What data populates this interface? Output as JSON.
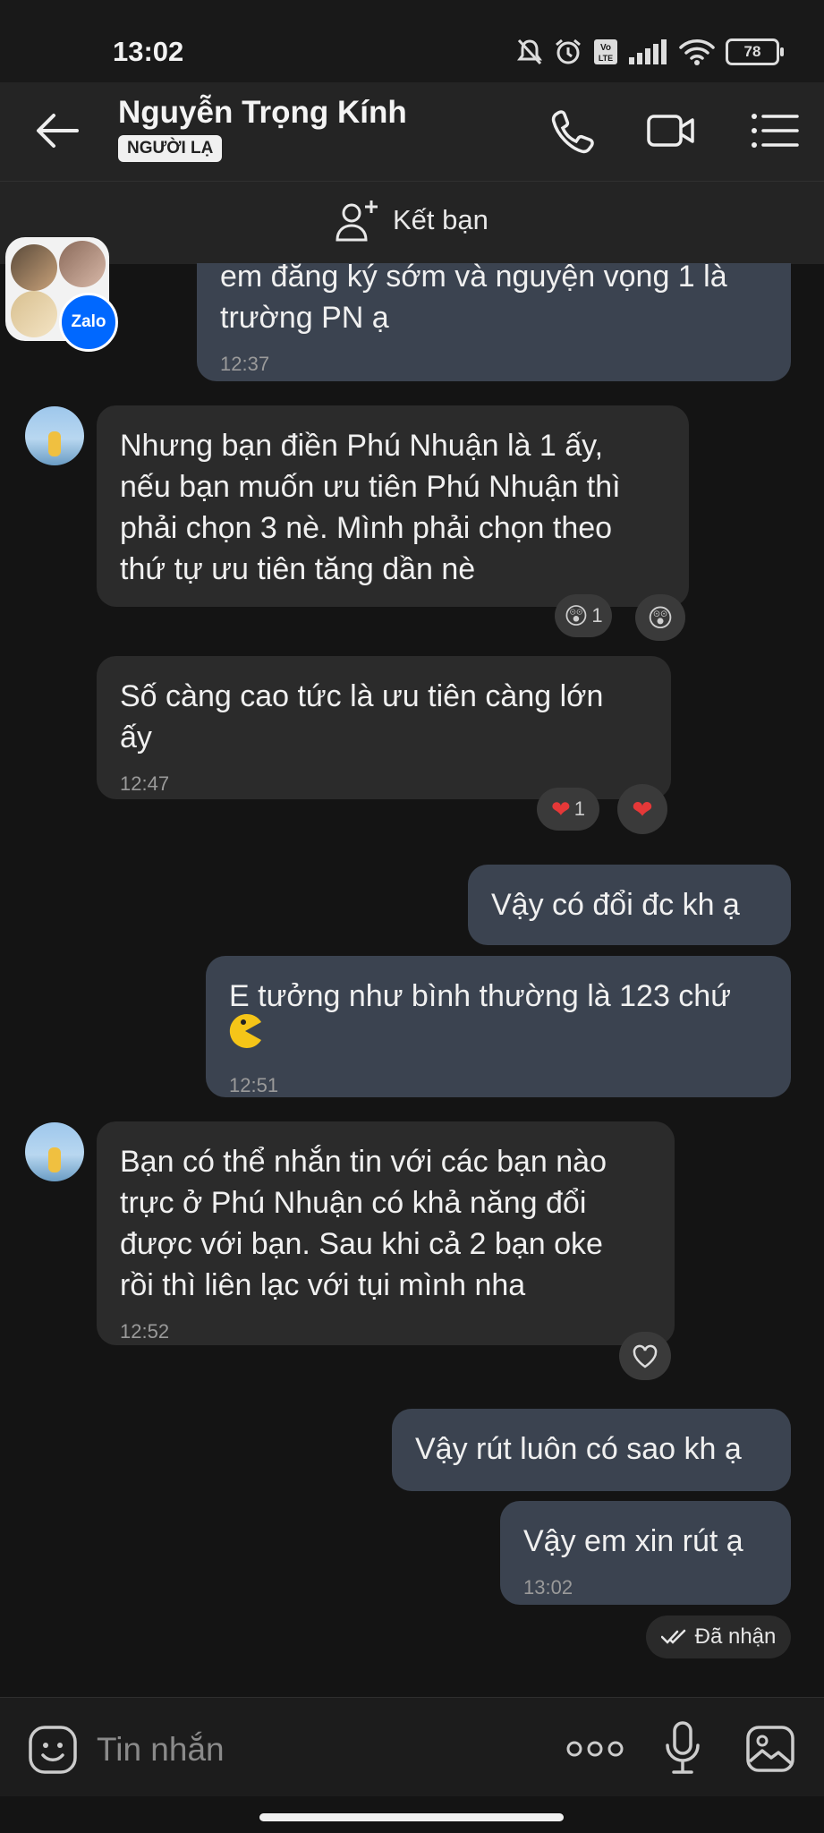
{
  "status_bar": {
    "time": "13:02",
    "network": "Vo LTE",
    "battery": "78"
  },
  "header": {
    "contact_name": "Nguyễn Trọng Kính",
    "badge": "NGƯỜI LẠ"
  },
  "add_friend": {
    "label": "Kết bạn"
  },
  "floating_bubble": {
    "label": "Zalo"
  },
  "messages": [
    {
      "side": "out",
      "text": "em đăng ký sớm và nguyện vọng 1 là\ntrường PN ạ",
      "time": "12:37"
    },
    {
      "side": "in",
      "text": "Nhưng bạn điền Phú Nhuận là 1 ấy,\nnếu bạn muốn ưu tiên Phú Nhuận thì\nphải chọn 3 nè. Mình phải chọn theo\nthứ tự ưu tiên tăng dần nè",
      "reaction_count": "1",
      "reaction": "wow"
    },
    {
      "side": "in",
      "text": "Số càng cao tức là ưu tiên càng lớn\nấy",
      "time": "12:47",
      "reaction_count": "1",
      "reaction": "heart"
    },
    {
      "side": "out",
      "text": "Vậy có đổi đc kh ạ"
    },
    {
      "side": "out",
      "text": "E tưởng như bình thường là 123 chứ",
      "time": "12:51",
      "sticker": "pacman-emoji"
    },
    {
      "side": "in",
      "text": "Bạn có thể nhắn tin với các bạn nào\ntrực ở Phú Nhuận có khả năng đổi\nđược với bạn. Sau khi cả 2 bạn oke\nrồi thì liên lạc với tụi mình nha",
      "time": "12:52",
      "reaction": "heart-outline"
    },
    {
      "side": "out",
      "text": "Vậy rút luôn có sao kh ạ"
    },
    {
      "side": "out",
      "text": "Vậy em xin rút ạ",
      "time": "13:02"
    }
  ],
  "delivery_status": "Đã nhận",
  "composer": {
    "placeholder": "Tin nhắn"
  },
  "colors": {
    "background": "#141414",
    "bubble_in": "#2b2b2b",
    "bubble_out": "#3b4350",
    "header": "#242424"
  }
}
